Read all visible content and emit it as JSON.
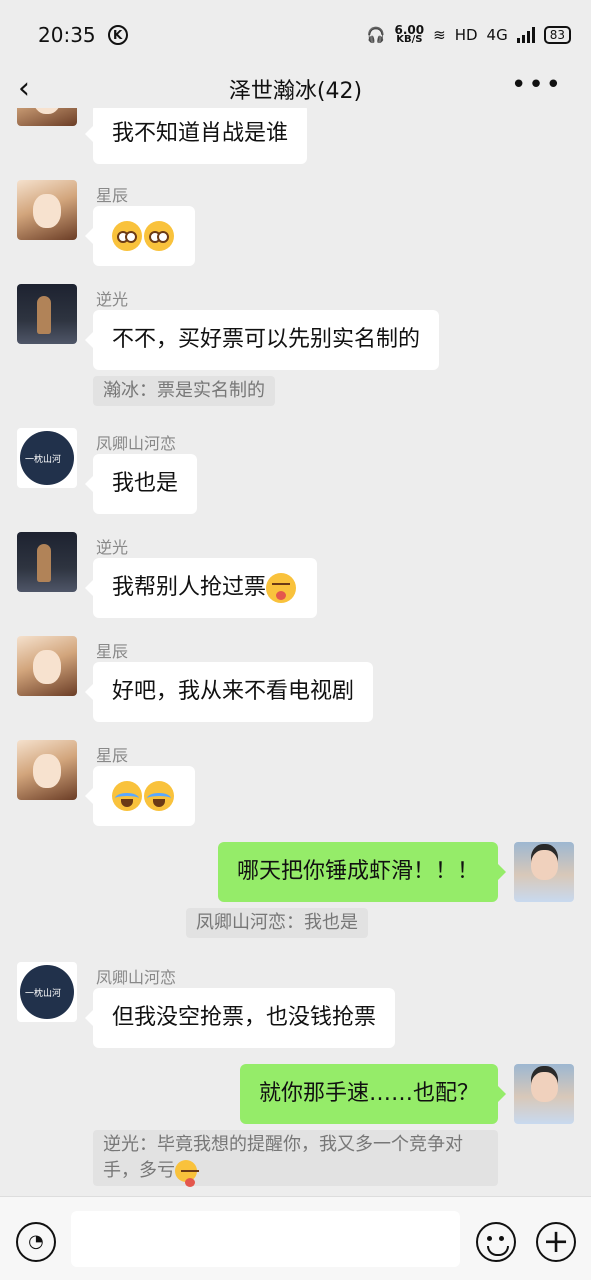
{
  "status_bar": {
    "time": "20:35",
    "k_icon": "K",
    "speed_value": "6.00",
    "speed_unit": "KB/S",
    "hd": "HD",
    "network": "4G",
    "battery": "83"
  },
  "header": {
    "title": "泽世瀚冰(42)",
    "back_icon": "chevron-left-icon",
    "more_icon": "more-icon"
  },
  "messages": [
    {
      "text": "我不知道肖战是谁"
    },
    {
      "sender": "星辰",
      "text": "",
      "emoji_names": [
        "flushed-face-icon",
        "flushed-face-icon"
      ]
    },
    {
      "sender": "逆光",
      "text": "不不，买好票可以先别实名制的",
      "quote": "瀚冰：票是实名制的"
    },
    {
      "sender": "凤卿山河恋",
      "text": "我也是"
    },
    {
      "sender": "逆光",
      "text": "我帮别人抢过票",
      "emoji_names": [
        "shy-face-icon"
      ]
    },
    {
      "sender": "星辰",
      "text": "好吧，我从来不看电视剧"
    },
    {
      "sender": "星辰",
      "text": "",
      "emoji_names": [
        "crying-laughing-icon",
        "crying-laughing-icon"
      ]
    },
    {
      "sender": "me",
      "text": "哪天把你锤成虾滑！！！",
      "quote": "凤卿山河恋：我也是"
    },
    {
      "sender": "凤卿山河恋",
      "text": "但我没空抢票，也没钱抢票"
    },
    {
      "sender": "me",
      "text": "就你那手速……也配？",
      "quote": "逆光：毕竟我想的提醒你，我又多一个竞争对手，多亏"
    }
  ],
  "avatar_label": "一枕山河",
  "bottom_bar": {
    "voice_icon": "voice-icon",
    "emoji_icon": "emoji-icon",
    "plus_icon": "plus-icon"
  }
}
